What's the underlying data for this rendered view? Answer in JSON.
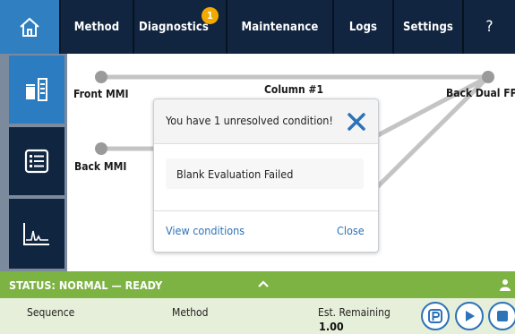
{
  "nav": {
    "items": [
      {
        "label": "Method"
      },
      {
        "label": "Diagnostics",
        "badge": "1"
      },
      {
        "label": "Maintenance"
      },
      {
        "label": "Logs"
      },
      {
        "label": "Settings"
      },
      {
        "label": "?"
      }
    ],
    "icons": [
      "home-icon",
      "flow-path-icon",
      "list-icon",
      "chromatogram-icon"
    ]
  },
  "flowpath": {
    "front_label": "Front MMI",
    "back_label": "Back MMI",
    "column_label": "Column #1",
    "detector_label": "Back Dual FPD"
  },
  "dialog": {
    "title": "You have 1 unresolved condition!",
    "condition": "Blank Evaluation Failed",
    "view_label": "View conditions",
    "close_label": "Close"
  },
  "status": {
    "text": "STATUS: NORMAL — READY"
  },
  "info": {
    "sequence_label": "Sequence",
    "method_label": "Method",
    "remaining_label": "Est. Remaining",
    "remaining_value": "1.00"
  },
  "colors": {
    "nav_bg": "#112540",
    "accent": "#2f7fc1",
    "status_green": "#7cb342",
    "badge": "#f2a900",
    "link": "#2c73b7"
  }
}
